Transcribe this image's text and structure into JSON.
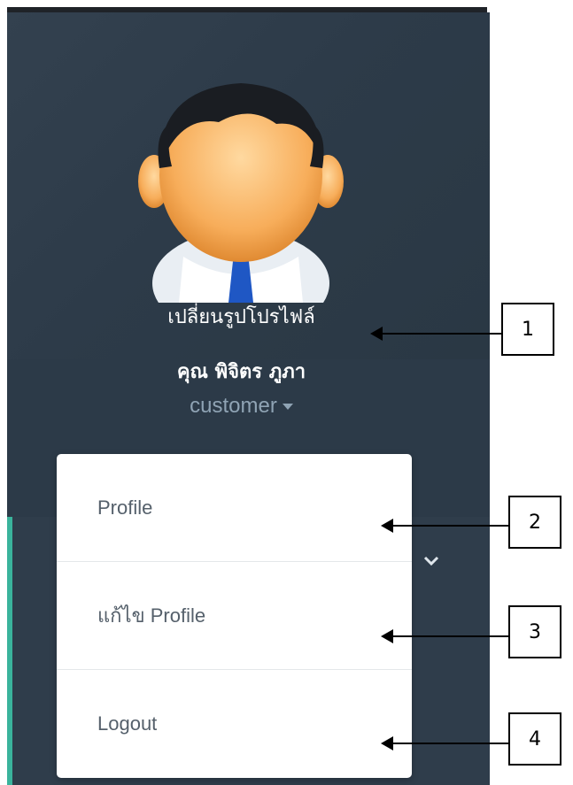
{
  "profile": {
    "change_photo_label": "เปลี่ยนรูปโปรไฟล์",
    "user_name": "คุณ พิจิตร ภูภา",
    "user_role": "customer"
  },
  "dropdown_menu": {
    "items": [
      {
        "label": "Profile"
      },
      {
        "label": "แก้ไข Profile"
      },
      {
        "label": "Logout"
      }
    ]
  },
  "callouts": [
    "1",
    "2",
    "3",
    "4"
  ],
  "colors": {
    "sidebar_bg": "#2c3a48",
    "accent_strip": "#3ab39c",
    "menu_text": "#55606b",
    "role_text": "#8fa3b4"
  },
  "icons": {
    "avatar": "user-avatar-icon",
    "role_caret": "caret-down-icon",
    "expand": "chevron-down-icon"
  }
}
